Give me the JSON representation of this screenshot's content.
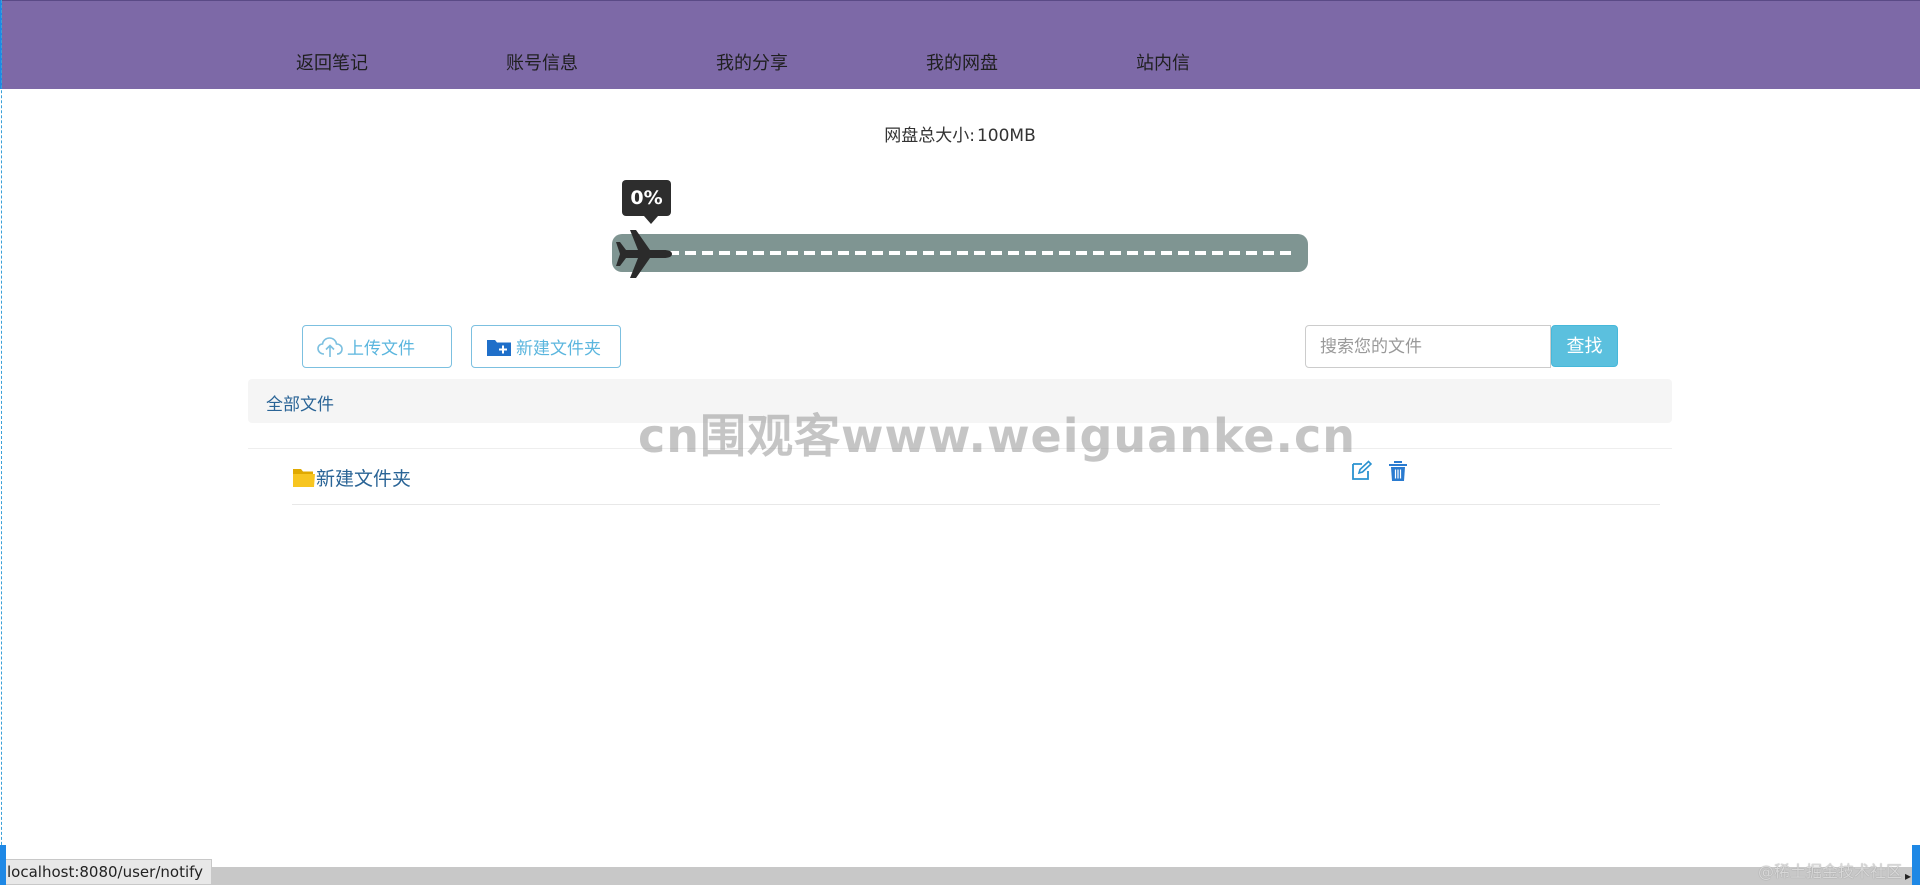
{
  "nav": {
    "items": [
      {
        "label": "返回笔记"
      },
      {
        "label": "账号信息"
      },
      {
        "label": "我的分享"
      },
      {
        "label": "我的网盘"
      },
      {
        "label": "站内信"
      }
    ]
  },
  "storage": {
    "label": "网盘总大小:",
    "total": "100MB",
    "usage_percent_text": "0%",
    "usage_fraction": 0
  },
  "toolbar": {
    "upload_label": "上传文件",
    "new_folder_label": "新建文件夹",
    "search_placeholder": "搜索您的文件",
    "search_button": "查找"
  },
  "breadcrumb": {
    "label": "全部文件"
  },
  "files": [
    {
      "name": "新建文件夹",
      "type": "folder"
    }
  ],
  "watermark": "cn围观客www.weiguanke.cn",
  "status_bar": {
    "url": "localhost:8080/user/notify"
  },
  "credit": "@稀土掘金技术社区",
  "colors": {
    "nav_bg": "#7d69a7",
    "progress_track": "#7f9592",
    "accent": "#5bc0de",
    "link": "#2a6496"
  }
}
